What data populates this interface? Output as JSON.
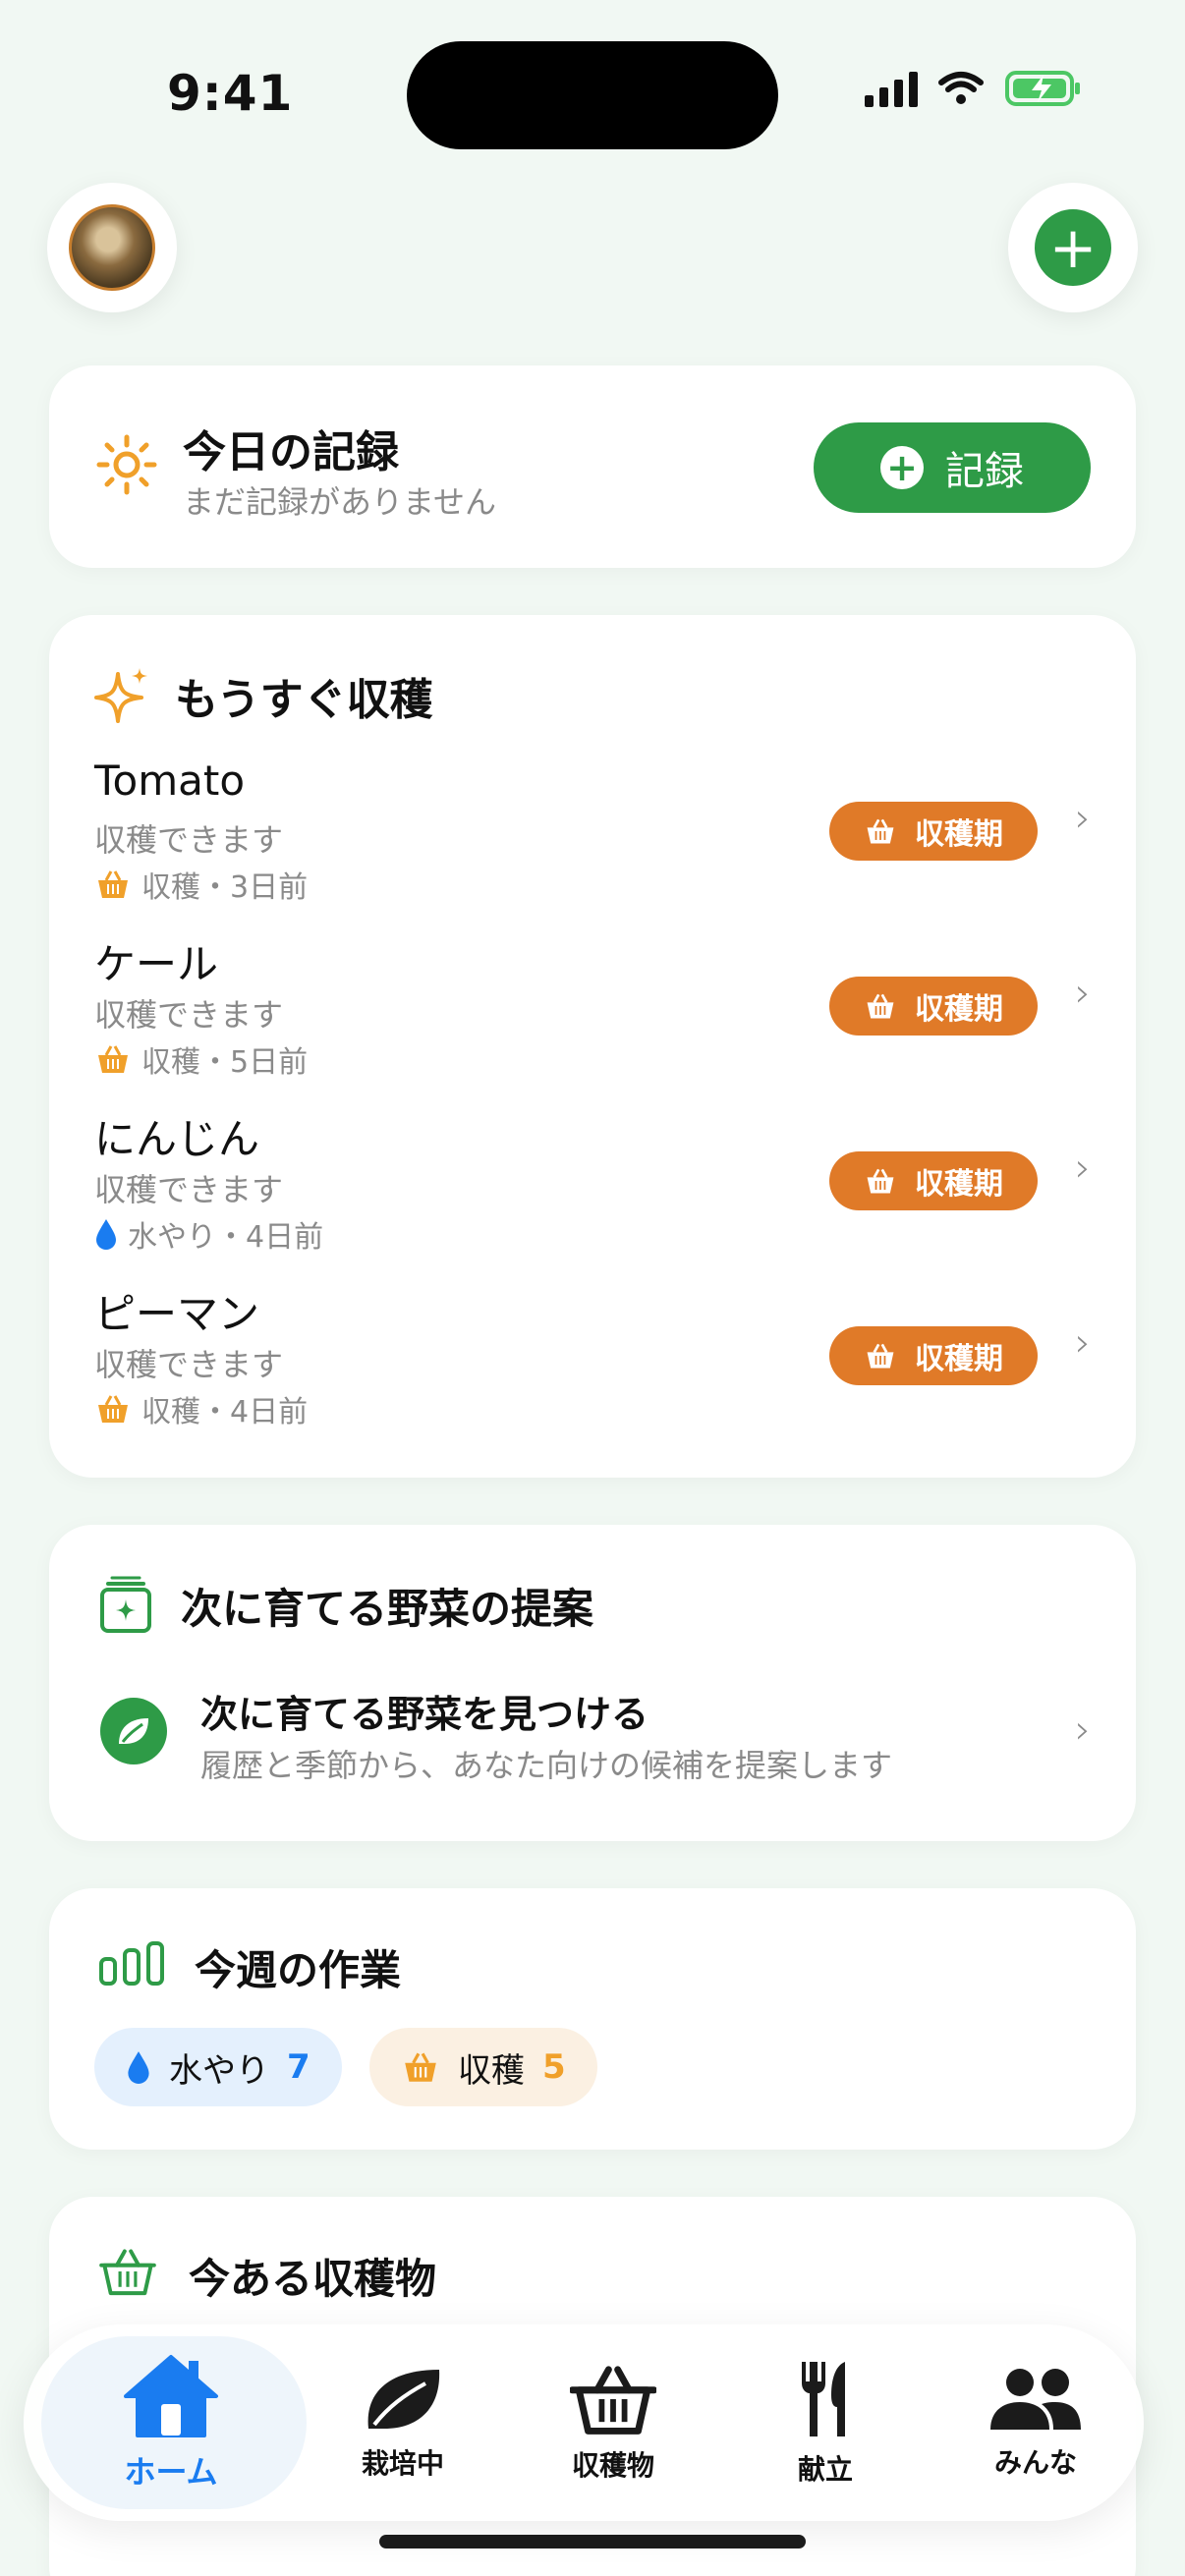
{
  "status": {
    "time": "9:41"
  },
  "today": {
    "title": "今日の記録",
    "subtitle": "まだ記録がありません",
    "record_label": "記録"
  },
  "harvest_soon": {
    "title": "もうすぐ収穫",
    "items": [
      {
        "name": "Tomato",
        "status": "収穫できます",
        "meta": "収穫・3日前",
        "meta_icon": "basket-icon",
        "badge": "収穫期"
      },
      {
        "name": "ケール",
        "status": "収穫できます",
        "meta": "収穫・5日前",
        "meta_icon": "basket-icon",
        "badge": "収穫期"
      },
      {
        "name": "にんじん",
        "status": "収穫できます",
        "meta": "水やり・4日前",
        "meta_icon": "water-drop-icon",
        "badge": "収穫期"
      },
      {
        "name": "ピーマン",
        "status": "収穫できます",
        "meta": "収穫・4日前",
        "meta_icon": "basket-icon",
        "badge": "収穫期"
      }
    ]
  },
  "next_veg": {
    "title": "次に育てる野菜の提案",
    "row_title": "次に育てる野菜を見つける",
    "row_subtitle": "履歴と季節から、あなた向けの候補を提案します"
  },
  "week": {
    "title": "今週の作業",
    "water_label": "水やり",
    "water_count": "7",
    "harvest_label": "収穫",
    "harvest_count": "5"
  },
  "stock": {
    "title": "今ある収穫物"
  },
  "tabs": {
    "home": "ホーム",
    "growing": "栽培中",
    "harvest": "収穫物",
    "menu": "献立",
    "community": "みんな"
  },
  "colors": {
    "green": "#2e9b47",
    "orange": "#e07a28",
    "blue": "#1a7cf0",
    "background": "#f1f8f3"
  }
}
